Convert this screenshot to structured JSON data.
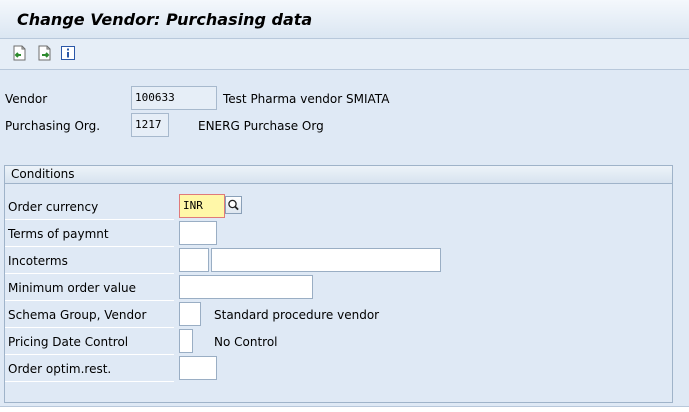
{
  "window": {
    "title": "Change Vendor: Purchasing data"
  },
  "toolbar": {
    "buttons": [
      {
        "icon": "previous-screen-icon"
      },
      {
        "icon": "next-screen-icon"
      },
      {
        "icon": "info-icon"
      }
    ]
  },
  "header": {
    "vendor": {
      "label": "Vendor",
      "value": "100633",
      "description": "Test Pharma vendor SMIATA"
    },
    "purch_org": {
      "label": "Purchasing Org.",
      "value": "1217",
      "description": "ENERG Purchase Org"
    }
  },
  "conditions": {
    "title": "Conditions",
    "order_currency": {
      "label": "Order currency",
      "value": "INR"
    },
    "terms_of_payment": {
      "label": "Terms of paymnt",
      "value": ""
    },
    "incoterms": {
      "label": "Incoterms",
      "value": "",
      "value2": ""
    },
    "min_order_value": {
      "label": "Minimum order value",
      "value": ""
    },
    "schema_group": {
      "label": "Schema Group, Vendor",
      "value": "",
      "description": "Standard procedure vendor"
    },
    "pricing_date_control": {
      "label": "Pricing Date Control",
      "value": "",
      "description": "No Control"
    },
    "order_optim": {
      "label": "Order optim.rest.",
      "value": ""
    }
  }
}
